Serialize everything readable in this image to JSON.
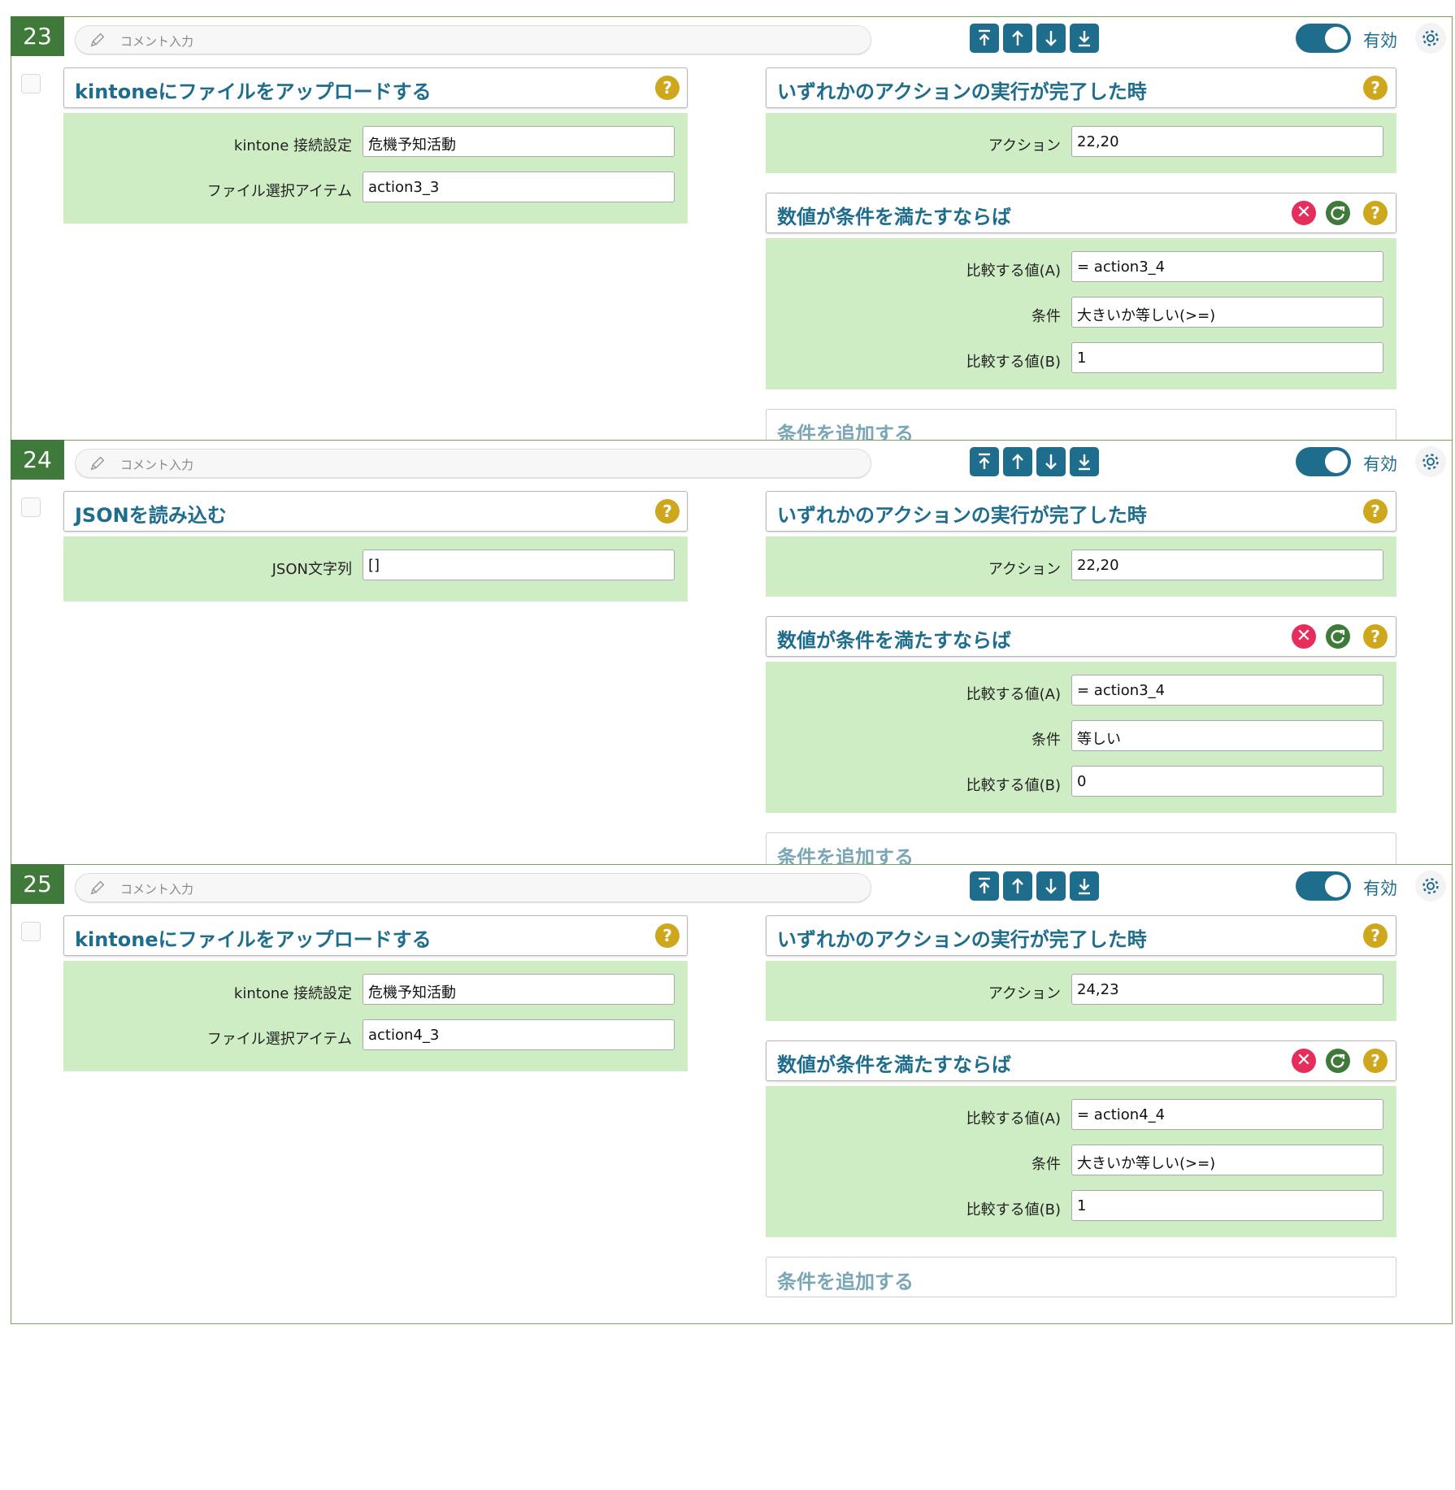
{
  "comment_placeholder": "コメント入力",
  "valid_label": "有効",
  "colors": {
    "accent": "#1f6d8c",
    "block_number_bg": "#3f7a3a",
    "panel_bg": "#cfedc4",
    "help": "#cfa71d",
    "delete": "#e62e5c"
  },
  "icons": {
    "comment": "pencil-icon",
    "move_top": "arrow-to-top-icon",
    "move_up": "arrow-up-icon",
    "move_down": "arrow-down-icon",
    "move_bottom": "arrow-to-bottom-icon",
    "settings": "gear-icon",
    "help": "question-icon",
    "delete": "close-icon",
    "refresh": "refresh-icon"
  },
  "add_condition_label": "条件を追加する",
  "blocks": [
    {
      "number": "23",
      "toggle_on": true,
      "action": {
        "title": "kintoneにファイルをアップロードする",
        "fields": [
          {
            "label": "kintone 接続設定",
            "value": "危機予知活動"
          },
          {
            "label": "ファイル選択アイテム",
            "value": "action3_3"
          }
        ]
      },
      "trigger": {
        "title": "いずれかのアクションの実行が完了した時",
        "fields": [
          {
            "label": "アクション",
            "value": "22,20"
          }
        ]
      },
      "condition": {
        "title": "数値が条件を満たすならば",
        "fields": [
          {
            "label": "比較する値(A)",
            "value": "= action3_4"
          },
          {
            "label": "条件",
            "value": "大きいか等しい(>=)"
          },
          {
            "label": "比較する値(B)",
            "value": "1"
          }
        ]
      }
    },
    {
      "number": "24",
      "toggle_on": true,
      "action": {
        "title": "JSONを読み込む",
        "fields": [
          {
            "label": "JSON文字列",
            "value": "[]"
          }
        ]
      },
      "trigger": {
        "title": "いずれかのアクションの実行が完了した時",
        "fields": [
          {
            "label": "アクション",
            "value": "22,20"
          }
        ]
      },
      "condition": {
        "title": "数値が条件を満たすならば",
        "fields": [
          {
            "label": "比較する値(A)",
            "value": "= action3_4"
          },
          {
            "label": "条件",
            "value": "等しい"
          },
          {
            "label": "比較する値(B)",
            "value": "0"
          }
        ]
      }
    },
    {
      "number": "25",
      "toggle_on": true,
      "action": {
        "title": "kintoneにファイルをアップロードする",
        "fields": [
          {
            "label": "kintone 接続設定",
            "value": "危機予知活動"
          },
          {
            "label": "ファイル選択アイテム",
            "value": "action4_3"
          }
        ]
      },
      "trigger": {
        "title": "いずれかのアクションの実行が完了した時",
        "fields": [
          {
            "label": "アクション",
            "value": "24,23"
          }
        ]
      },
      "condition": {
        "title": "数値が条件を満たすならば",
        "fields": [
          {
            "label": "比較する値(A)",
            "value": "= action4_4"
          },
          {
            "label": "条件",
            "value": "大きいか等しい(>=)"
          },
          {
            "label": "比較する値(B)",
            "value": "1"
          }
        ]
      }
    }
  ]
}
